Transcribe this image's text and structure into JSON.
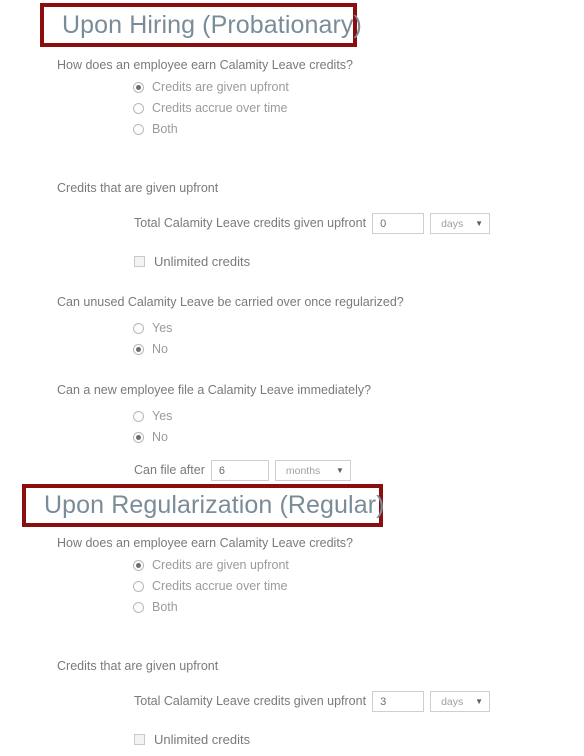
{
  "sections": [
    {
      "header": "Upon Hiring (Probationary)",
      "earn_question": "How does an employee earn Calamity Leave credits?",
      "earn_options": [
        {
          "label": "Credits are given upfront",
          "selected": true
        },
        {
          "label": "Credits accrue over time",
          "selected": false
        },
        {
          "label": "Both",
          "selected": false
        }
      ],
      "upfront_group_label": "Credits that are given upfront",
      "upfront_field_label": "Total Calamity Leave credits given upfront",
      "upfront_value": "0",
      "upfront_unit": "days",
      "unlimited_label": "Unlimited credits",
      "unlimited_checked": false,
      "carryover_question": "Can unused Calamity Leave be carried over once regularized?",
      "carryover_options": [
        {
          "label": "Yes",
          "selected": false
        },
        {
          "label": "No",
          "selected": true
        }
      ],
      "immediate_question": "Can a new employee file a Calamity Leave immediately?",
      "immediate_options": [
        {
          "label": "Yes",
          "selected": false
        },
        {
          "label": "No",
          "selected": true
        }
      ],
      "can_file_label": "Can file after",
      "can_file_value": "6",
      "can_file_unit": "months"
    },
    {
      "header": "Upon Regularization (Regular)",
      "earn_question": "How does an employee earn Calamity Leave credits?",
      "earn_options": [
        {
          "label": "Credits are given upfront",
          "selected": true
        },
        {
          "label": "Credits accrue over time",
          "selected": false
        },
        {
          "label": "Both",
          "selected": false
        }
      ],
      "upfront_group_label": "Credits that are given upfront",
      "upfront_field_label": "Total Calamity Leave credits given upfront",
      "upfront_value": "3",
      "upfront_unit": "days",
      "unlimited_label": "Unlimited credits",
      "unlimited_checked": false
    }
  ],
  "icons": {
    "caret_down": "▼"
  },
  "colors": {
    "highlight_border": "#8c0d0d",
    "header_text": "#7b8c99",
    "body_text": "#7a7a7a",
    "muted_text": "#9b9b9b"
  }
}
